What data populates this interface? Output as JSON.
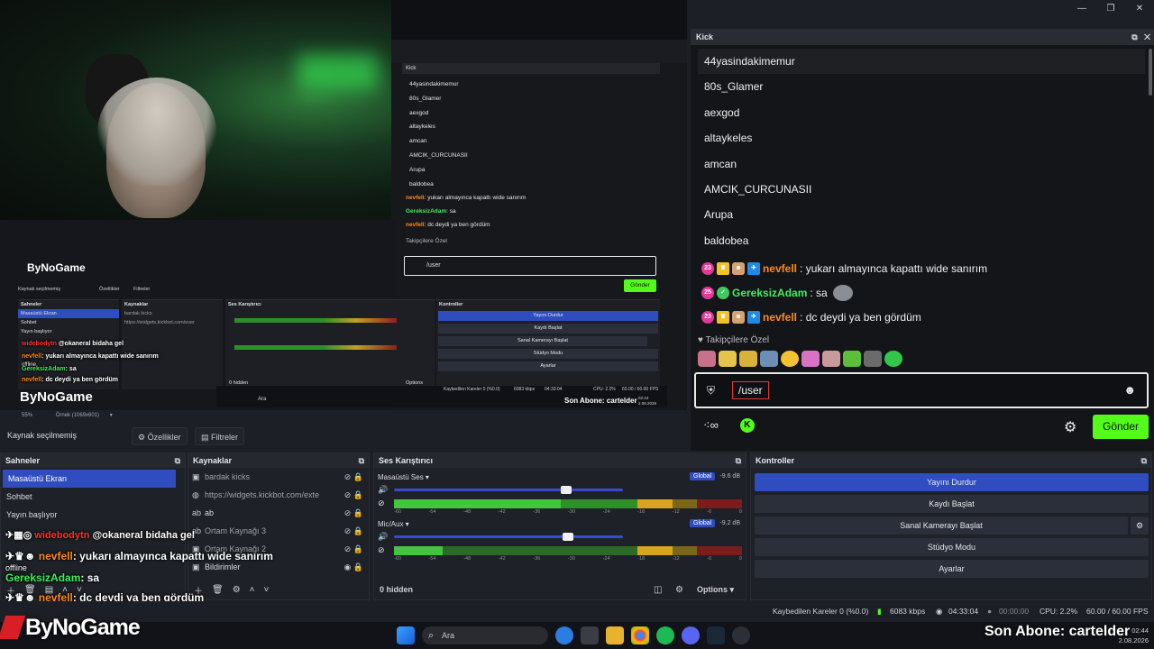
{
  "preview": {
    "nested": {
      "kick_title": "Kick",
      "users": [
        "44yasindakimemur",
        "80s_Glamer",
        "aexgod",
        "altaykeles",
        "amcan",
        "AMCIK_CURCUNASII",
        "Arupa",
        "baldobea"
      ],
      "chat": [
        {
          "user": "nevfell",
          "text": "yukarı almayınca kapattı wide sanırım"
        },
        {
          "user": "GereksizAdam",
          "text": "sa"
        },
        {
          "user": "nevfell",
          "text": "dc deydi ya ben gördüm"
        }
      ],
      "followers_label": "Takipçilere Özel",
      "input_value": "/user",
      "send_label": "Gönder"
    },
    "mini": {
      "source_label": "Kaynak seçilmemiş",
      "properties_label": "Özellikler",
      "filters_label": "Filtreler",
      "scenes_title": "Sahneler",
      "scenes": [
        "Masaüstü Ekran",
        "Sohbet",
        "Yayın başlıyor"
      ],
      "sources_title": "Kaynaklar",
      "source_1": "bardak kicks",
      "source_2": "https://widgets.kickbot.com/ever",
      "mixer_title": "Ses Karıştırıcı",
      "controls_title": "Kontroller",
      "controls": [
        "Yayını Durdur",
        "Kaydı Başlat",
        "Sanal Kamerayı Başlat",
        "Stüdyo Modu",
        "Ayarlar"
      ],
      "hidden_label": "0 hidden",
      "options_label": "Options",
      "brand": "ByNoGame",
      "subscriber": "Son Abone: cartelder",
      "chat_line_1_user": "widebodytn",
      "chat_line_1_text": "@okaneral bidaha gel",
      "chat_line_2_user": "nevfell",
      "chat_line_2_text": "yukarı almayınca kapattı wide sanırım",
      "offline": "offline",
      "chat_line_3_user": "GereksizAdam",
      "chat_line_3_text": "sa",
      "chat_line_4_user": "nevfell",
      "chat_line_4_text": "dc deydi ya ben gördüm",
      "status_frames": "Kaybedilen Kareler 0 (%0.0)",
      "status_kbps": "6083 kbps",
      "status_time": "04:33:04",
      "status_cpu": "CPU: 2.2%",
      "status_fps": "60.00 / 60.00 FPS",
      "search": "Ara",
      "clock_time": "02:44",
      "clock_date": "2.08.2026"
    },
    "zoom": "55%",
    "output": "Örnek (1069x601)"
  },
  "kick": {
    "title": "Kick",
    "users": [
      "44yasindakimemur",
      "80s_Glamer",
      "aexgod",
      "altaykeles",
      "amcan",
      "AMCIK_CURCUNASII",
      "Arupa",
      "baldobea"
    ],
    "chat": [
      {
        "badge": "23",
        "user": "nevfell",
        "text": "yukarı almayınca kapattı wide sanırım",
        "color": "orange"
      },
      {
        "badge": "25",
        "user": "GereksizAdam",
        "text": "sa",
        "color": "green"
      },
      {
        "badge": "23",
        "user": "nevfell",
        "text": "dc deydi ya ben gördüm",
        "color": "orange"
      }
    ],
    "followers_label": "Takipçilere Özel",
    "input_value": "/user",
    "send_label": "Gönder"
  },
  "source_bar": {
    "label": "Kaynak seçilmemiş",
    "properties": "Özellikler",
    "filters": "Filtreler"
  },
  "scenes": {
    "title": "Sahneler",
    "items": [
      "Masaüstü Ekran",
      "Sohbet",
      "Yayın başlıyor"
    ],
    "selected": "Masaüstü Ekran"
  },
  "sources": {
    "title": "Kaynaklar",
    "items": [
      {
        "icon": "image-icon",
        "label": "bardak kicks"
      },
      {
        "icon": "globe-icon",
        "label": "https://widgets.kickbot.com/exte"
      },
      {
        "icon": "text-icon",
        "label": "ab"
      },
      {
        "icon": "text-icon",
        "label": "Ortam Kaynağı 3"
      },
      {
        "icon": "image-icon",
        "label": "Ortam Kaynağı 2"
      },
      {
        "icon": "image-icon",
        "label": "Bildirimler"
      }
    ]
  },
  "mixer": {
    "title": "Ses Karıştırıcı",
    "channels": [
      {
        "name": "Masaüstü Ses",
        "badge": "Global",
        "db": "-9.6 dB",
        "level": 0.75
      },
      {
        "name": "Mic/Aux",
        "badge": "Global",
        "db": "-9.2 dB",
        "level": 0.76
      }
    ],
    "ticks": [
      "-60",
      "-54",
      "-48",
      "-42",
      "-36",
      "-30",
      "-24",
      "-18",
      "-12",
      "-6",
      "0"
    ],
    "hidden": "0 hidden",
    "options": "Options"
  },
  "controls": {
    "title": "Kontroller",
    "stop_stream": "Yayını Durdur",
    "start_recording": "Kaydı Başlat",
    "start_virtual_cam": "Sanal Kamerayı Başlat",
    "studio_mode": "Stüdyo Modu",
    "settings": "Ayarlar"
  },
  "status": {
    "dropped_frames": "Kaybedilen Kareler 0 (%0.0)",
    "bitrate": "6083 kbps",
    "stream_time": "04:33:04",
    "record_time": "00:00:00",
    "cpu": "CPU: 2.2%",
    "fps": "60.00 / 60.00 FPS"
  },
  "overlay": {
    "chat": [
      {
        "user": "widebodytn",
        "text": "@okaneral bidaha gel",
        "color": "red"
      },
      {
        "user": "nevfell",
        "text": "yukarı almayınca kapattı wide sanırım",
        "color": "orange"
      },
      {
        "user": "",
        "text": "offline",
        "color": "white"
      },
      {
        "user": "GereksizAdam",
        "text": "sa",
        "color": "green"
      },
      {
        "user": "nevfell",
        "text": "dc deydi ya ben gördüm",
        "color": "orange"
      }
    ],
    "brand": "ByNoGame",
    "subscriber": "Son Abone: cartelder"
  },
  "taskbar": {
    "search": "Ara",
    "time": "02:44",
    "date": "2.08.2026"
  },
  "colors": {
    "accent": "#2f4dbf",
    "kick_green": "#53fc18",
    "bg": "#1d1f26"
  }
}
